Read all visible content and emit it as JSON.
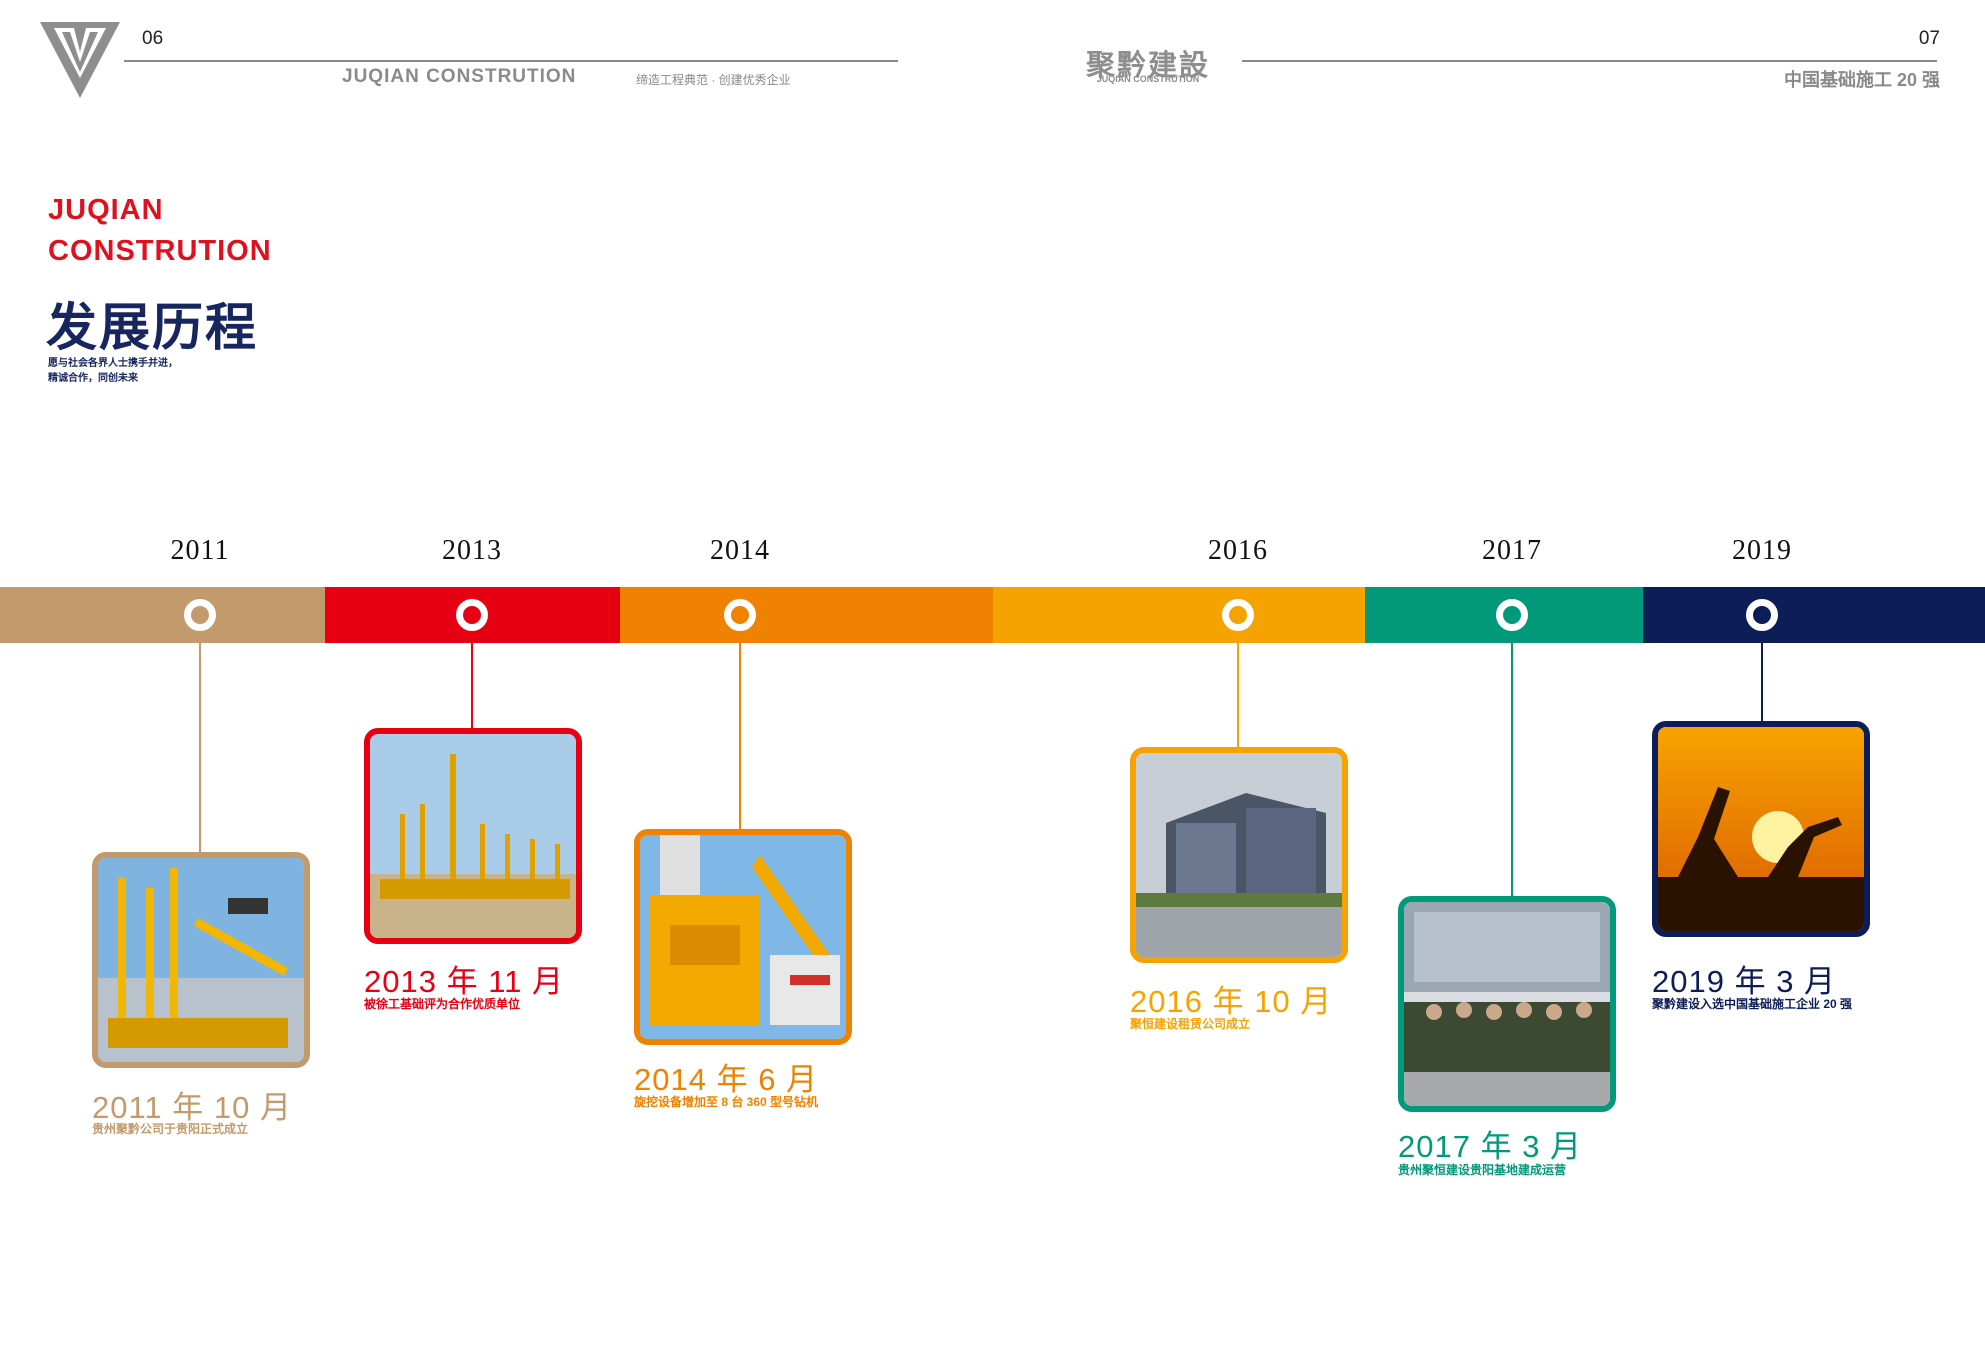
{
  "header": {
    "page_left": "06",
    "brand_en": "JUQIAN CONSTRUTION",
    "slogan": "缔造工程典范 · 创建优秀企业",
    "logo_cn": "聚黔建設",
    "logo_en": "JUQIAN CONSTRUTION",
    "page_right": "07",
    "top20": "中国基础施工 20 强"
  },
  "section": {
    "title_en_line1": "JUQIAN",
    "title_en_line2": "CONSTRUTION",
    "title_cn": "发展历程",
    "subtitle_line1": "愿与社会各界人士携手并进，",
    "subtitle_line2": "精诚合作，同创未来"
  },
  "timeline": {
    "years": [
      "2011",
      "2013",
      "2014",
      "2016",
      "2017",
      "2019"
    ],
    "segment_colors": [
      "#c39a6b",
      "#e60012",
      "#ef8200",
      "#f5a300",
      "#00997a",
      "#0d1d57"
    ],
    "events": [
      {
        "date": "2011 年 10 月",
        "text": "贵州聚黔公司于贵阳正式成立",
        "color": "#c39a6b",
        "photo": "drilling-rigs-expo"
      },
      {
        "date": "2013 年 11 月",
        "text": "被徐工基础评为合作优质单位",
        "color": "#e60012",
        "photo": "rig-fleet"
      },
      {
        "date": "2014 年 6 月",
        "text": "旋挖设备增加至 8 台 360 型号钻机",
        "color": "#ef8200",
        "photo": "rotary-drill-closeup"
      },
      {
        "date": "2016 年 10 月",
        "text": "聚恒建设租赁公司成立",
        "color": "#f5a300",
        "photo": "office-building"
      },
      {
        "date": "2017 年 3 月",
        "text": "贵州聚恒建设贵阳基地建成运营",
        "color": "#00997a",
        "photo": "team-group"
      },
      {
        "date": "2019 年 3 月",
        "text": "聚黔建设入选中国基础施工企业 20 强",
        "color": "#0d1d57",
        "photo": "excavator-sunset"
      }
    ]
  }
}
